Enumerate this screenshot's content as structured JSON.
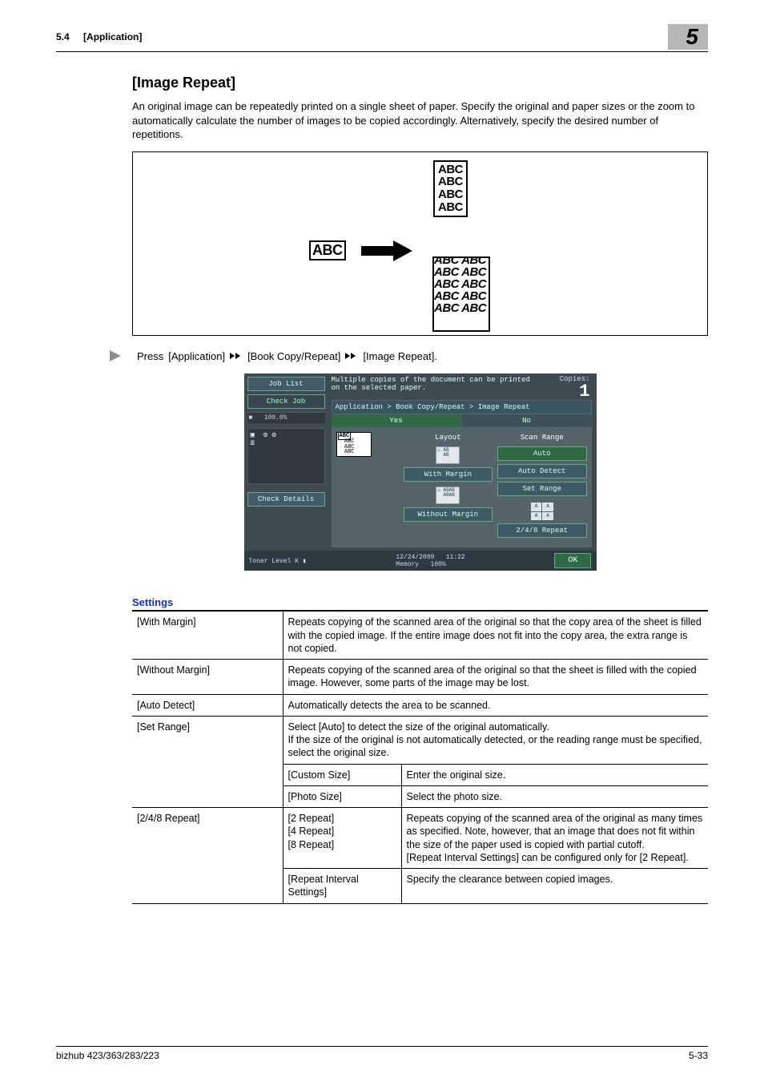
{
  "header": {
    "section_no": "5.4",
    "section_title": "[Application]",
    "chapter_no": "5"
  },
  "title": "[Image Repeat]",
  "intro": "An original image can be repeatedly printed on a single sheet of paper. Specify the original and paper sizes or the zoom to automatically calculate the number of images to be copied accordingly. Alternatively, specify the desired number of repetitions.",
  "illustration": {
    "source": "ABC",
    "stack1": [
      "ABC",
      "ABC",
      "ABC",
      "ABC"
    ],
    "stack2": [
      "ABC ABC",
      "ABC ABC",
      "ABC ABC",
      "ABC ABC",
      "ABC ABC"
    ]
  },
  "nav": {
    "prefix": "Press",
    "p1": "[Application]",
    "p2": "[Book Copy/Repeat]",
    "p3": "[Image Repeat]."
  },
  "screen": {
    "left": {
      "job_list": "Job List",
      "check_job": "Check Job",
      "ratio": "100.0%",
      "check_details": "Check Details",
      "toner_label": "Toner Level",
      "toner_key": "K"
    },
    "title_line1": "Multiple copies of the document can be printed",
    "title_line2": "on the selected paper.",
    "copies_label": "Copies:",
    "copies_value": "1",
    "breadcrumb": "Application > Book Copy/Repeat > Image Repeat",
    "tabs": {
      "yes": "Yes",
      "no": "No"
    },
    "col1_lines": [
      "ABC",
      "ABC",
      "ABC",
      "ABC"
    ],
    "col2": {
      "heading": "Layout",
      "with_margin": "With Margin",
      "without_margin": "Without Margin"
    },
    "col3": {
      "heading": "Scan Range",
      "auto": "Auto",
      "auto_detect": "Auto Detect",
      "set_range": "Set Range",
      "grid_cell": "A",
      "repeat248": "2/4/8 Repeat"
    },
    "footer": {
      "date": "12/24/2009",
      "time": "11:22",
      "mem_label": "Memory",
      "mem_val": "100%",
      "ok": "OK"
    }
  },
  "settings": {
    "heading": "Settings",
    "rows": {
      "with_margin": {
        "label": "[With Margin]",
        "desc": "Repeats copying of the scanned area of the original so that the copy area of the sheet is filled with the copied image. If the entire image does not fit into the copy area, the extra range is not copied."
      },
      "without_margin": {
        "label": "[Without Margin]",
        "desc": "Repeats copying of the scanned area of the original so that the sheet is filled with the copied image. However, some parts of the image may be lost."
      },
      "auto_detect": {
        "label": "[Auto Detect]",
        "desc": "Automatically detects the area to be scanned."
      },
      "set_range": {
        "label": "[Set Range]",
        "desc": "Select [Auto] to detect the size of the original automatically.\nIf the size of the original is not automatically detected, or the reading range must be specified, select the original size.",
        "custom_size": {
          "label": "[Custom Size]",
          "desc": "Enter the original size."
        },
        "photo_size": {
          "label": "[Photo Size]",
          "desc": "Select the photo size."
        }
      },
      "repeat248": {
        "label": "[2/4/8 Repeat]",
        "sub_label": "[2 Repeat]\n[4 Repeat]\n[8 Repeat]",
        "sub_desc": "Repeats copying of the scanned area of the original as many times as specified. Note, however, that an image that does not fit within the size of the paper used is copied with partial cutoff.\n[Repeat Interval Settings] can be configured only for [2 Repeat].",
        "interval_label": "[Repeat Interval Settings]",
        "interval_desc": "Specify the clearance between copied images."
      }
    }
  },
  "footer": {
    "model": "bizhub 423/363/283/223",
    "page": "5-33"
  }
}
